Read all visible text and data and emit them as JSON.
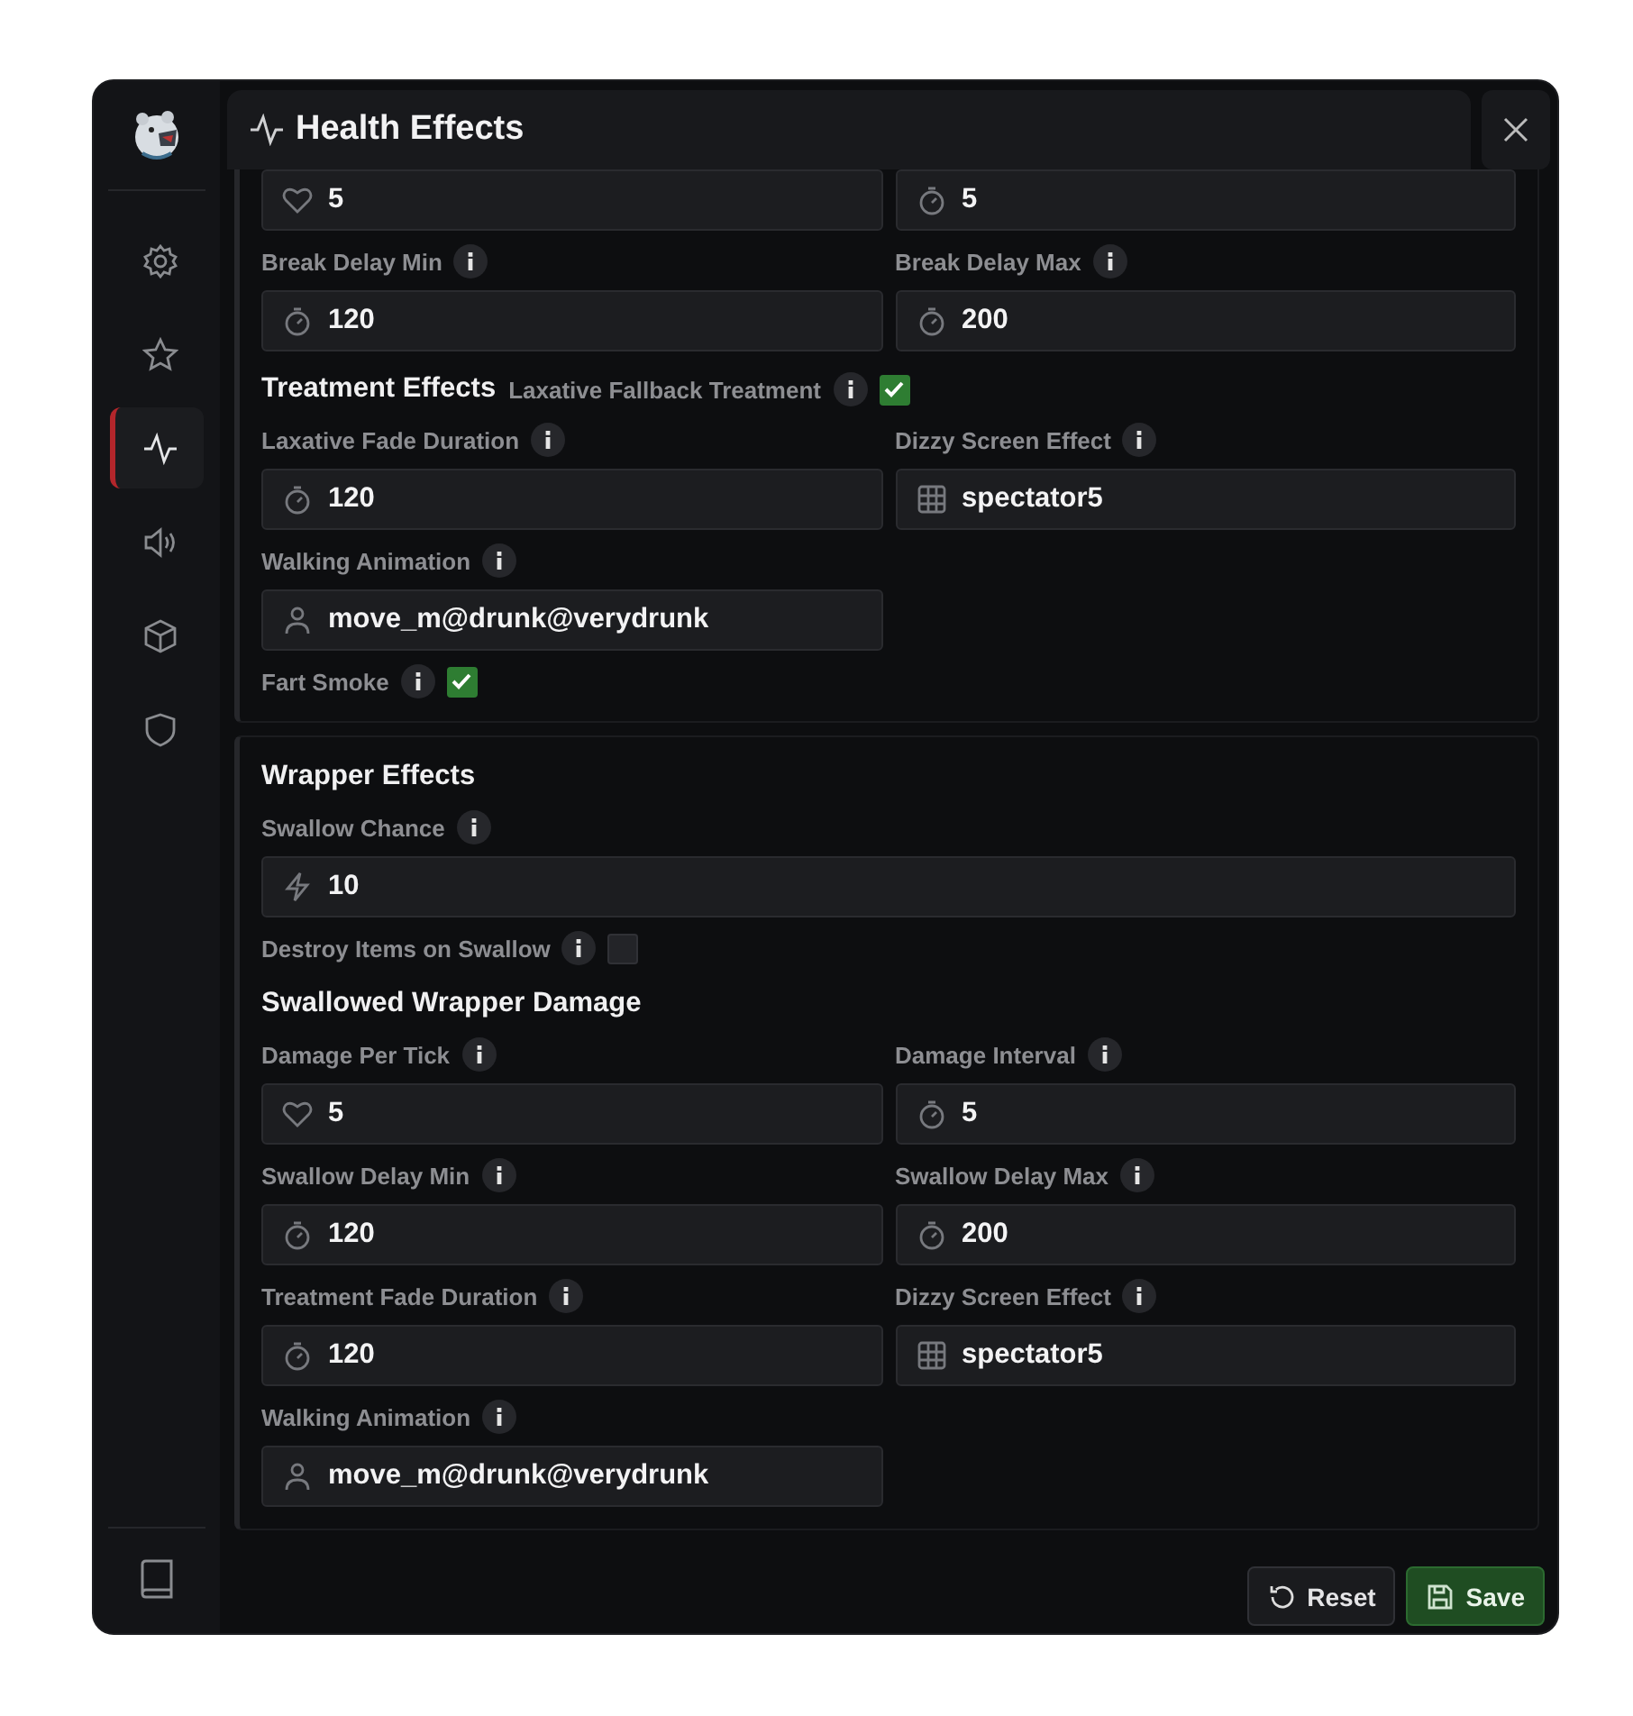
{
  "window": {
    "title": "Health Effects"
  },
  "sidebar": {
    "items": [
      {
        "selected": false
      },
      {
        "selected": false
      },
      {
        "selected": true
      },
      {
        "selected": false
      },
      {
        "selected": false
      },
      {
        "selected": false
      }
    ]
  },
  "panels": [
    {
      "items": [
        {
          "kind": "fields",
          "fields": [
            {
              "value": "5",
              "kind": "health",
              "wide": false
            },
            {
              "value": "5",
              "kind": "duration",
              "wide": false
            }
          ]
        },
        {
          "kind": "fields",
          "fields": [
            {
              "label": "Break Delay Min",
              "value": "120",
              "kind": "duration",
              "wide": false
            },
            {
              "label": "Break Delay Max",
              "value": "200",
              "kind": "duration",
              "wide": false
            }
          ]
        },
        {
          "kind": "heading",
          "text": "Treatment Effects",
          "toggle": {
            "label": "Laxative Fallback Treatment",
            "checked": true
          }
        },
        {
          "kind": "fields",
          "fields": [
            {
              "label": "Laxative Fade Duration",
              "value": "120",
              "kind": "duration",
              "wide": false
            },
            {
              "label": "Dizzy Screen Effect",
              "value": "spectator5",
              "kind": "effect",
              "wide": false
            }
          ]
        },
        {
          "kind": "fields",
          "fields": [
            {
              "label": "Walking Animation",
              "value": "move_m@drunk@verydrunk",
              "kind": "animation",
              "wide": false
            }
          ]
        },
        {
          "kind": "checkbox",
          "label": "Fart Smoke",
          "checked": true
        }
      ]
    },
    {
      "items": [
        {
          "kind": "heading",
          "text": "Wrapper Effects"
        },
        {
          "kind": "fields",
          "fields": [
            {
              "label": "Swallow Chance",
              "value": "10",
              "kind": "chance",
              "wide": true
            }
          ]
        },
        {
          "kind": "checkbox",
          "label": "Destroy Items on Swallow",
          "checked": false
        },
        {
          "kind": "heading",
          "text": "Swallowed Wrapper Damage"
        },
        {
          "kind": "fields",
          "fields": [
            {
              "label": "Damage Per Tick",
              "value": "5",
              "kind": "health",
              "wide": false
            },
            {
              "label": "Damage Interval",
              "value": "5",
              "kind": "duration",
              "wide": false
            }
          ]
        },
        {
          "kind": "fields",
          "fields": [
            {
              "label": "Swallow Delay Min",
              "value": "120",
              "kind": "duration",
              "wide": false
            },
            {
              "label": "Swallow Delay Max",
              "value": "200",
              "kind": "duration",
              "wide": false
            }
          ]
        },
        {
          "kind": "fields",
          "fields": [
            {
              "label": "Treatment Fade Duration",
              "value": "120",
              "kind": "duration",
              "wide": false
            },
            {
              "label": "Dizzy Screen Effect",
              "value": "spectator5",
              "kind": "effect",
              "wide": false
            }
          ]
        },
        {
          "kind": "fields",
          "fields": [
            {
              "label": "Walking Animation",
              "value": "move_m@drunk@verydrunk",
              "kind": "animation",
              "wide": false
            }
          ]
        }
      ]
    }
  ],
  "buttons": [
    {
      "label": "Reset",
      "kind": "secondary"
    },
    {
      "label": "Save",
      "kind": "primary"
    }
  ]
}
